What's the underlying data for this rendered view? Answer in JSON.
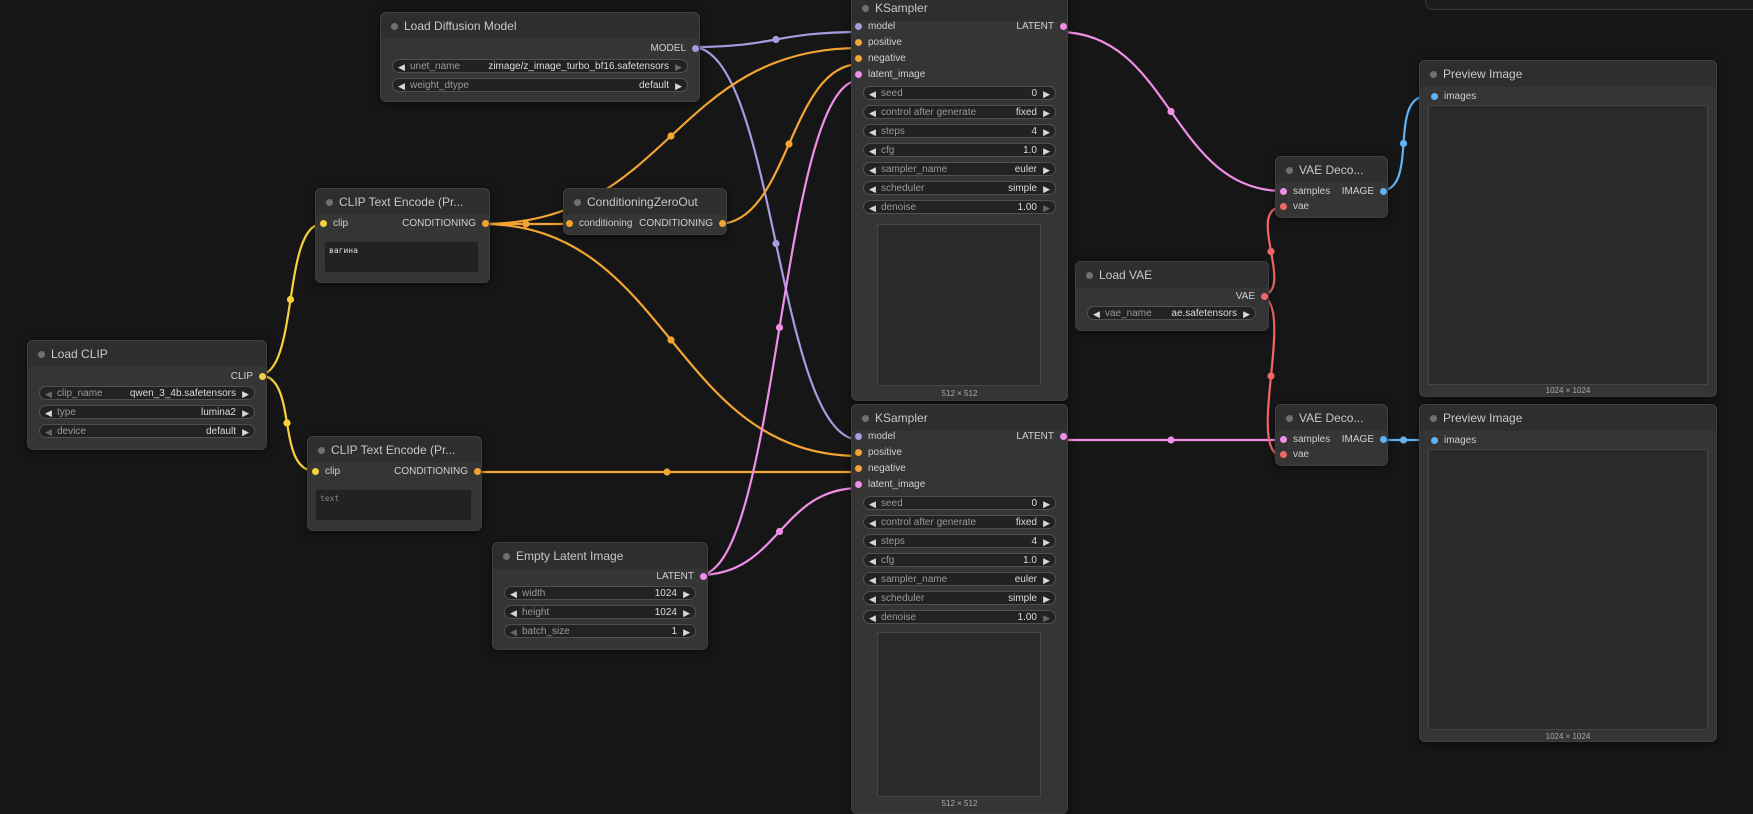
{
  "colors": {
    "model": "#a89be0",
    "clip": "#f5d23b",
    "conditioning": "#f3a533",
    "latent": "#f08ee8",
    "vae": "#f06767",
    "image": "#61b3f2"
  },
  "nodes": {
    "load_diffusion": {
      "title": "Load Diffusion Model",
      "out_model": "MODEL",
      "w_unet_label": "unet_name",
      "w_unet_value": "zimage/z_image_turbo_bf16.safetensors",
      "w_dtype_label": "weight_dtype",
      "w_dtype_value": "default"
    },
    "load_clip": {
      "title": "Load CLIP",
      "out_clip": "CLIP",
      "w_clipname_label": "clip_name",
      "w_clipname_value": "qwen_3_4b.safetensors",
      "w_type_label": "type",
      "w_type_value": "lumina2",
      "w_device_label": "device",
      "w_device_value": "default"
    },
    "clip_text_1": {
      "title": "CLIP Text Encode (Pr...",
      "in_clip": "clip",
      "out_cond": "CONDITIONING",
      "text": "вагина"
    },
    "clip_text_2": {
      "title": "CLIP Text Encode (Pr...",
      "in_clip": "clip",
      "out_cond": "CONDITIONING",
      "placeholder": "text"
    },
    "cond_zero": {
      "title": "ConditioningZeroOut",
      "in_cond": "conditioning",
      "out_cond": "CONDITIONING"
    },
    "empty_latent": {
      "title": "Empty Latent Image",
      "out_latent": "LATENT",
      "w_width_label": "width",
      "w_width_value": "1024",
      "w_height_label": "height",
      "w_height_value": "1024",
      "w_batch_label": "batch_size",
      "w_batch_value": "1"
    },
    "ksampler_1": {
      "title": "KSampler",
      "in_model": "model",
      "in_positive": "positive",
      "in_negative": "negative",
      "in_latent": "latent_image",
      "out_latent": "LATENT",
      "seed_label": "seed",
      "seed": "0",
      "cag_label": "control after generate",
      "cag": "fixed",
      "steps_label": "steps",
      "steps": "4",
      "cfg_label": "cfg",
      "cfg": "1.0",
      "sampler_label": "sampler_name",
      "sampler": "euler",
      "scheduler_label": "scheduler",
      "scheduler": "simple",
      "denoise_label": "denoise",
      "denoise": "1.00",
      "size": "512 × 512"
    },
    "ksampler_2": {
      "title": "KSampler",
      "in_model": "model",
      "in_positive": "positive",
      "in_negative": "negative",
      "in_latent": "latent_image",
      "out_latent": "LATENT",
      "seed_label": "seed",
      "seed": "0",
      "cag_label": "control after generate",
      "cag": "fixed",
      "steps_label": "steps",
      "steps": "4",
      "cfg_label": "cfg",
      "cfg": "1.0",
      "sampler_label": "sampler_name",
      "sampler": "euler",
      "scheduler_label": "scheduler",
      "scheduler": "simple",
      "denoise_label": "denoise",
      "denoise": "1.00",
      "size": "512 × 512"
    },
    "load_vae": {
      "title": "Load VAE",
      "out_vae": "VAE",
      "w_vae_label": "vae_name",
      "w_vae_value": "ae.safetensors"
    },
    "vae_decode_1": {
      "title": "VAE Deco...",
      "in_samples": "samples",
      "in_vae": "vae",
      "out_image": "IMAGE"
    },
    "vae_decode_2": {
      "title": "VAE Deco...",
      "in_samples": "samples",
      "in_vae": "vae",
      "out_image": "IMAGE"
    },
    "preview_1": {
      "title": "Preview Image",
      "in_images": "images",
      "size": "1024 × 1024"
    },
    "preview_2": {
      "title": "Preview Image",
      "in_images": "images",
      "size": "1024 × 1024"
    }
  }
}
